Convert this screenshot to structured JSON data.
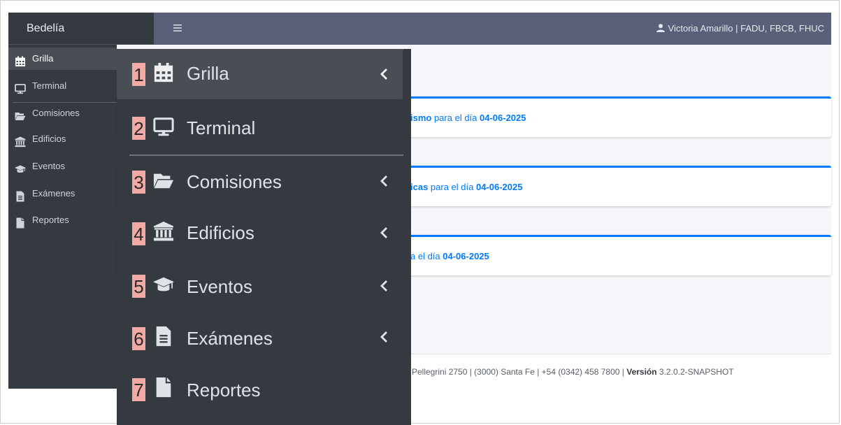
{
  "brand": {
    "name": "Bedelía"
  },
  "header": {
    "menu_icon": "hamburger-icon",
    "user_icon": "user-icon",
    "user_text": "Victoria Amarillo | FADU, FBCB, FHUC"
  },
  "sidebar": {
    "items": [
      {
        "label": "Grilla",
        "icon": "calendar-icon",
        "active": true
      },
      {
        "label": "Terminal",
        "icon": "desktop-icon"
      },
      {
        "label": "Comisiones",
        "icon": "folder-open-icon"
      },
      {
        "label": "Edificios",
        "icon": "university-icon"
      },
      {
        "label": "Eventos",
        "icon": "graduation-cap-icon"
      },
      {
        "label": "Exámenes",
        "icon": "file-text-icon"
      },
      {
        "label": "Reportes",
        "icon": "file-icon"
      }
    ]
  },
  "cards": [
    {
      "pre": "ismo",
      "mid": " para el día ",
      "date": "04-06-2025"
    },
    {
      "pre": "icas",
      "mid": " para el día ",
      "date": "04-06-2025"
    },
    {
      "pre": "",
      "mid": "a el día ",
      "date": "04-06-2025"
    }
  ],
  "footer": {
    "text": "Pellegrini 2750 | (3000) Santa Fe | +54 (0342) 458 7800 | ",
    "version_label": "Versión",
    "version": " 3.2.0.2-SNAPSHOT"
  },
  "zoom_menu": {
    "items": [
      {
        "num": "1",
        "label": "Grilla",
        "icon": "calendar-icon",
        "chevron": true,
        "active": true
      },
      {
        "num": "2",
        "label": "Terminal",
        "icon": "desktop-icon",
        "chevron": false
      },
      {
        "num": "3",
        "label": "Comisiones",
        "icon": "folder-open-icon",
        "chevron": true
      },
      {
        "num": "4",
        "label": "Edificios",
        "icon": "university-icon",
        "chevron": true
      },
      {
        "num": "5",
        "label": "Eventos",
        "icon": "graduation-cap-icon",
        "chevron": true
      },
      {
        "num": "6",
        "label": "Exámenes",
        "icon": "file-text-icon",
        "chevron": true
      },
      {
        "num": "7",
        "label": "Reportes",
        "icon": "file-icon",
        "chevron": false
      }
    ]
  },
  "colors": {
    "sidebar_bg": "#343a40",
    "topbar_bg": "#5a6077",
    "accent": "#007bff",
    "badge": "#f3a9a4"
  }
}
